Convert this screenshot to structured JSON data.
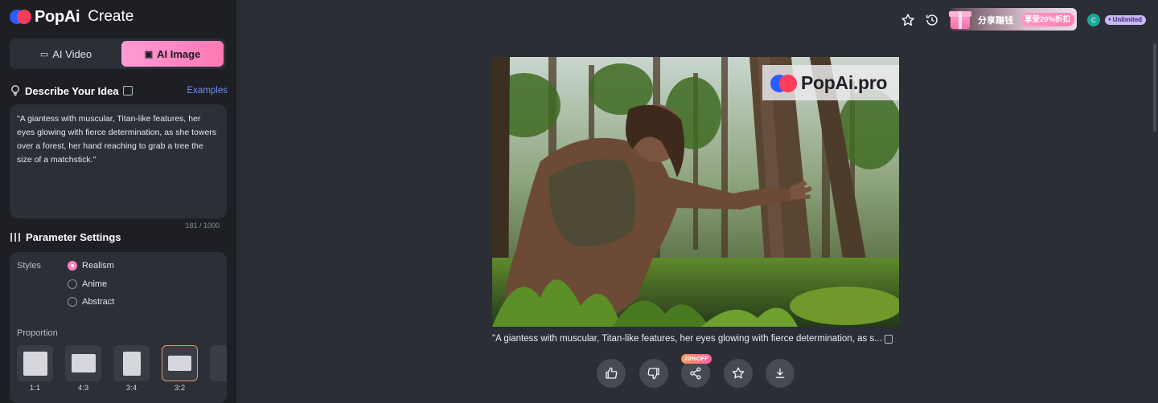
{
  "brand": {
    "name": "PopAi",
    "section": "Create"
  },
  "mode_tabs": [
    {
      "label": "AI Video",
      "icon": "video-icon",
      "active": false
    },
    {
      "label": "AI Image",
      "icon": "image-icon",
      "active": true
    }
  ],
  "describe": {
    "title": "Describe Your Idea",
    "examples_label": "Examples",
    "prompt": "\"A giantess with muscular, Titan-like features, her eyes glowing with fierce determination, as she towers over a forest, her hand reaching to grab a tree the size of a matchstick.\"",
    "counter": "181 / 1000"
  },
  "parameters": {
    "title": "Parameter Settings",
    "styles_label": "Styles",
    "styles": [
      {
        "label": "Realism",
        "selected": true
      },
      {
        "label": "Anime",
        "selected": false
      },
      {
        "label": "Abstract",
        "selected": false
      }
    ],
    "proportion_label": "Proportion",
    "ratios": [
      {
        "label": "1:1",
        "selected": false
      },
      {
        "label": "4:3",
        "selected": false
      },
      {
        "label": "3:4",
        "selected": false
      },
      {
        "label": "3:2",
        "selected": true
      }
    ]
  },
  "topbar": {
    "promo_text": "分享赚钱",
    "promo_pill": "享受20%折扣",
    "avatar_initial": "C",
    "plan_badge": "Unlimited"
  },
  "result": {
    "watermark": "PopAi.pro",
    "caption": "\"A giantess with muscular, Titan-like features, her eyes glowing with fierce determination, as s...",
    "share_badge": "20%OFF"
  },
  "colors": {
    "accent_pink": "#ff79b4",
    "link_blue": "#6f8dff",
    "sidebar_bg": "#1d1f24",
    "main_bg": "#2b2e35"
  }
}
